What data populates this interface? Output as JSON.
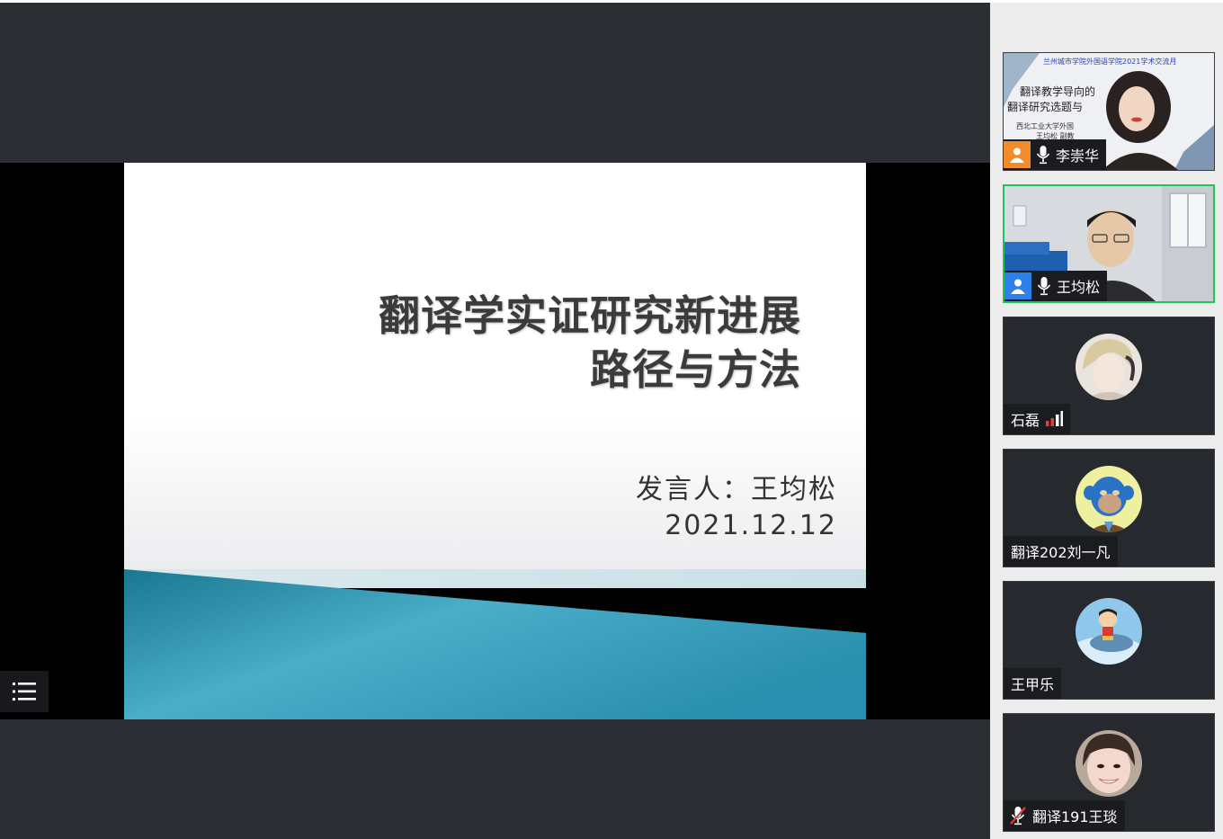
{
  "slide": {
    "title_line1": "翻译学实证研究新进展",
    "title_line2": "路径与方法",
    "speaker_line": "发言人：王均松",
    "date_line": "2021.12.12"
  },
  "controls": {
    "participant_list_icon": "list-icon"
  },
  "participants": [
    {
      "name": "李崇华",
      "badge": "person-icon",
      "badge_color": "#f28b2a",
      "mic": "microphone-icon",
      "video": true,
      "backdrop": {
        "line1": "兰州城市学院外国语学院2021学术交流月",
        "line2": "翻译教学导向的",
        "line3": "翻译研究选题与",
        "line4": "西北工业大学外国",
        "line5": "王均松 副教"
      }
    },
    {
      "name": "王均松",
      "badge": "person-icon",
      "badge_color": "#2f7fe8",
      "mic": "microphone-icon",
      "video": true,
      "active_speaker": true
    },
    {
      "name": "石磊",
      "signal": "signal-bars-icon",
      "signal_color": "#e63b3b"
    },
    {
      "name": "翻译202刘一凡"
    },
    {
      "name": "王甲乐"
    },
    {
      "name": "翻译191王琰",
      "mic": "microphone-muted-icon"
    }
  ],
  "colors": {
    "stage_bg": "#2b2e33",
    "active_border": "#21c35b",
    "slide_teal": "#1f7f9b"
  }
}
